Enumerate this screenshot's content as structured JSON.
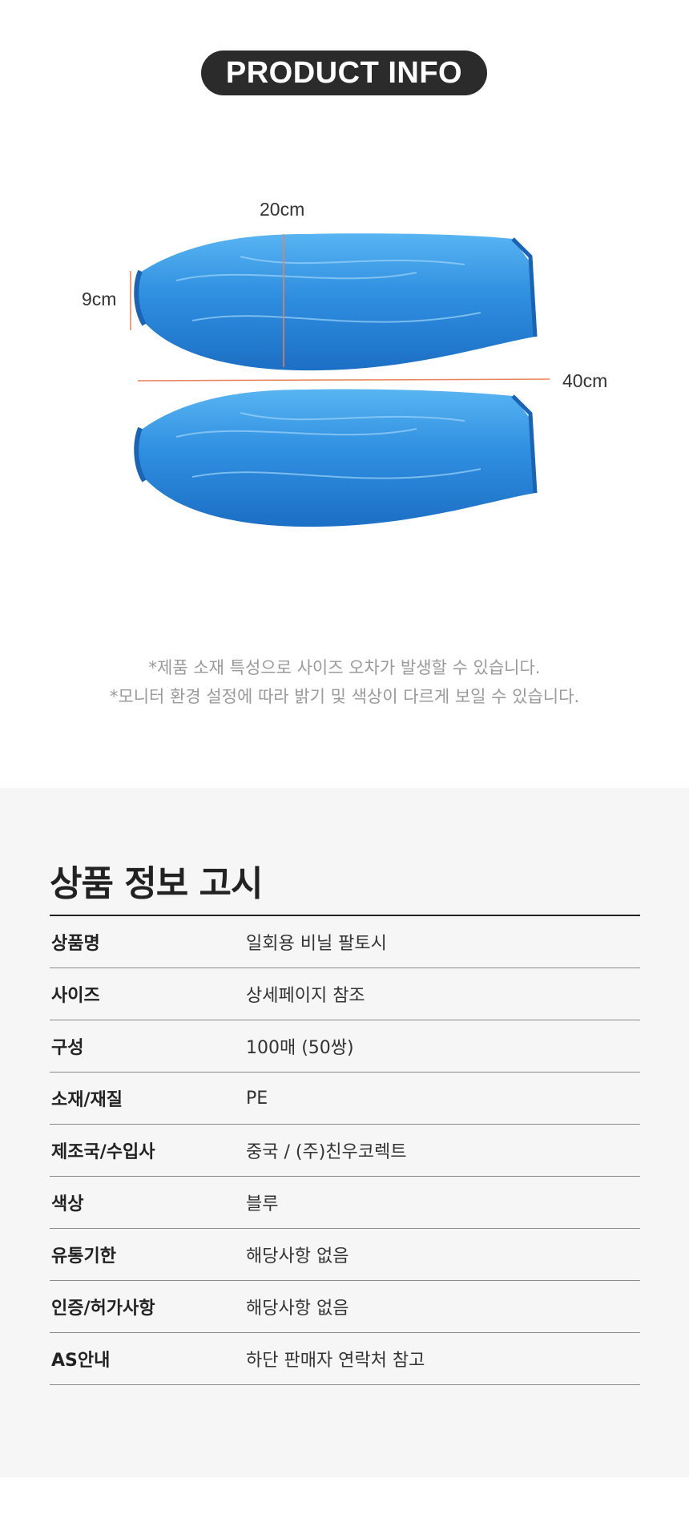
{
  "header": {
    "badge": "PRODUCT INFO"
  },
  "product": {
    "image": "blue-plastic-arm-sleeves",
    "dimensions": {
      "width_top": "20cm",
      "height_left": "9cm",
      "length": "40cm"
    },
    "colors": {
      "sleeve": "#2f8fe0",
      "measure_line": "#e8825a"
    }
  },
  "notes": [
    "*제품 소재 특성으로 사이즈 오차가 발생할 수 있습니다.",
    "*모니터 환경 설정에 따라 밝기 및 색상이 다르게 보일 수 있습니다."
  ],
  "notice": {
    "title": "상품 정보 고시",
    "rows": [
      {
        "label": "상품명",
        "value": "일회용 비닐 팔토시"
      },
      {
        "label": "사이즈",
        "value": "상세페이지 참조"
      },
      {
        "label": "구성",
        "value": "100매 (50쌍)"
      },
      {
        "label": "소재/재질",
        "value": "PE"
      },
      {
        "label": "제조국/수입사",
        "value": "중국 / (주)친우코렉트"
      },
      {
        "label": "색상",
        "value": "블루"
      },
      {
        "label": "유통기한",
        "value": "해당사항 없음"
      },
      {
        "label": "인증/허가사항",
        "value": "해당사항 없음"
      },
      {
        "label": "AS안내",
        "value": "하단 판매자 연락처 참고"
      }
    ]
  }
}
